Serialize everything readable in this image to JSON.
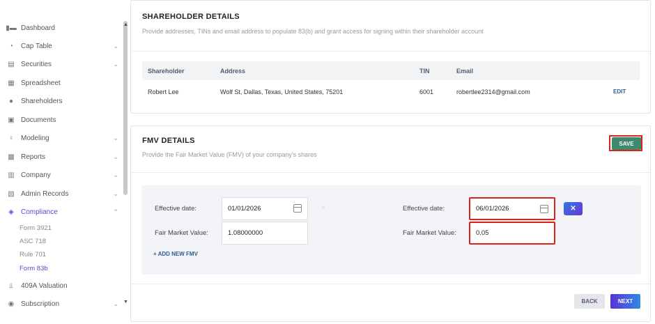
{
  "sidebar": {
    "items": [
      {
        "label": "Dashboard",
        "icon": "dashboard-icon",
        "glyph": "▮▬",
        "chevron": ""
      },
      {
        "label": "Cap Table",
        "icon": "pie-chart-icon",
        "glyph": "◔",
        "chevron": "⌄"
      },
      {
        "label": "Securities",
        "icon": "clipboard-icon",
        "glyph": "▤",
        "chevron": "⌄"
      },
      {
        "label": "Spreadsheet",
        "icon": "spreadsheet-icon",
        "glyph": "▦",
        "chevron": ""
      },
      {
        "label": "Shareholders",
        "icon": "person-icon",
        "glyph": "●",
        "chevron": ""
      },
      {
        "label": "Documents",
        "icon": "documents-icon",
        "glyph": "▣",
        "chevron": ""
      },
      {
        "label": "Modeling",
        "icon": "lightbulb-icon",
        "glyph": "♀",
        "chevron": "⌄"
      },
      {
        "label": "Reports",
        "icon": "reports-icon",
        "glyph": "▩",
        "chevron": "⌄"
      },
      {
        "label": "Company",
        "icon": "building-icon",
        "glyph": "▥",
        "chevron": "⌄"
      },
      {
        "label": "Admin Records",
        "icon": "admin-records-icon",
        "glyph": "▧",
        "chevron": "⌄"
      },
      {
        "label": "Compliance",
        "icon": "shield-check-icon",
        "glyph": "◈",
        "chevron": "⌃"
      },
      {
        "label": "409A Valuation",
        "icon": "valuation-icon",
        "glyph": "⫫",
        "chevron": ""
      },
      {
        "label": "Subscription",
        "icon": "subscription-icon",
        "glyph": "◉",
        "chevron": "⌄"
      }
    ],
    "sub_items": [
      "Form 3921",
      "ASC 718",
      "Rule 701",
      "Form 83b"
    ]
  },
  "shareholder_details": {
    "title": "SHAREHOLDER DETAILS",
    "subtitle": "Provide addresses, TINs and email address to populate 83(b) and grant access for signing within their shareholder account",
    "columns": [
      "Shareholder",
      "Address",
      "TIN",
      "Email"
    ],
    "row": {
      "shareholder": "Robert Lee",
      "address": "Wolf St, Dallas, Texas, United States, 75201",
      "tin": "6001",
      "email": "robertlee2314@gmail.com"
    },
    "edit_label": "EDIT"
  },
  "fmv_details": {
    "title": "FMV DETAILS",
    "subtitle": "Provide the Fair Market Value (FMV) of your company's shares",
    "save_label": "SAVE",
    "entries": [
      {
        "effective_date_label": "Effective date:",
        "effective_date": "01/01/2026",
        "fmv_label": "Fair Market Value:",
        "fmv": "1.08000000"
      },
      {
        "effective_date_label": "Effective date:",
        "effective_date": "06/01/2026",
        "fmv_label": "Fair Market Value:",
        "fmv": "0.05"
      }
    ],
    "add_label": "+ ADD NEW FMV",
    "remove_glyph": "✕",
    "faint_glyph": "×"
  },
  "footer": {
    "back_label": "BACK",
    "next_label": "NEXT"
  }
}
